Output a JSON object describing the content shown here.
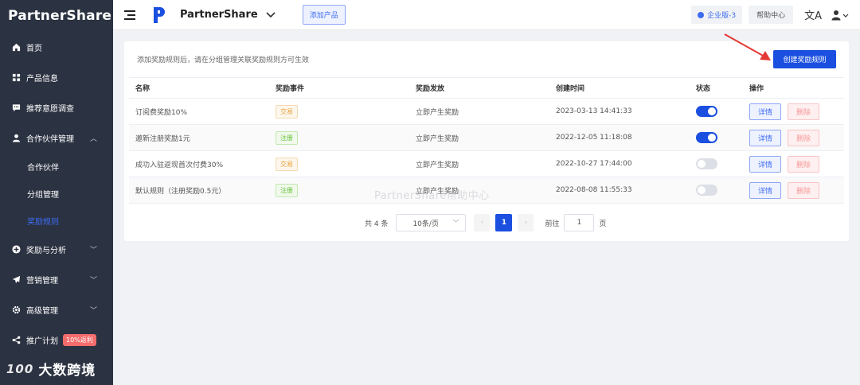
{
  "sidebar": {
    "logo": "PartnerShare",
    "items": [
      {
        "label": "首页"
      },
      {
        "label": "产品信息"
      },
      {
        "label": "推荐意愿调查"
      },
      {
        "label": "合作伙伴管理"
      },
      {
        "label": "奖励与分析"
      },
      {
        "label": "营销管理"
      },
      {
        "label": "高级管理"
      },
      {
        "label": "推广计划"
      }
    ],
    "sub_items": [
      {
        "label": "合作伙伴"
      },
      {
        "label": "分组管理"
      },
      {
        "label": "奖励规则"
      }
    ],
    "promo_badge": "10%返利",
    "brand_footer": "大数跨境",
    "brand_mark": "100"
  },
  "header": {
    "app_name": "PartnerShare",
    "add_product": "添加产品",
    "plan": "企业版-3",
    "help": "帮助中心",
    "lang_glyph": "文A"
  },
  "main": {
    "hint": "添加奖励规则后，请在分组管理关联奖励规则方可生效",
    "create_button": "创建奖励规则",
    "columns": [
      "名称",
      "奖励事件",
      "奖励发放",
      "创建时间",
      "状态",
      "操作"
    ],
    "rows": [
      {
        "name": "订阅费奖励10%",
        "event": "交易",
        "event_type": "trade",
        "grant": "立即产生奖励",
        "created": "2023-03-13 14:41:33",
        "status": true,
        "detail": "详情",
        "delete": "删除"
      },
      {
        "name": "邀新注册奖励1元",
        "event": "注册",
        "event_type": "reg",
        "grant": "立即产生奖励",
        "created": "2022-12-05 11:18:08",
        "status": true,
        "detail": "详情",
        "delete": "删除"
      },
      {
        "name": "成功入驻返现首次付费30%",
        "event": "交易",
        "event_type": "trade",
        "grant": "立即产生奖励",
        "created": "2022-10-27 17:44:00",
        "status": false,
        "detail": "详情",
        "delete": "删除"
      },
      {
        "name": "默认规则（注册奖励0.5元）",
        "event": "注册",
        "event_type": "reg",
        "grant": "立即产生奖励",
        "created": "2022-08-08 11:55:33",
        "status": false,
        "detail": "详情",
        "delete": "删除"
      }
    ],
    "watermark": "PartnerShare帮助中心"
  },
  "pagination": {
    "total": "共 4 条",
    "page_size": "10条/页",
    "prev": "‹",
    "current": "1",
    "next": "›",
    "goto_label": "前往",
    "goto_value": "1",
    "goto_suffix": "页"
  },
  "colors": {
    "accent": "#1a4fe0",
    "sidebar_bg": "#2b3241",
    "active_nav": "#3d6cf2",
    "arrow": "#e53935"
  }
}
